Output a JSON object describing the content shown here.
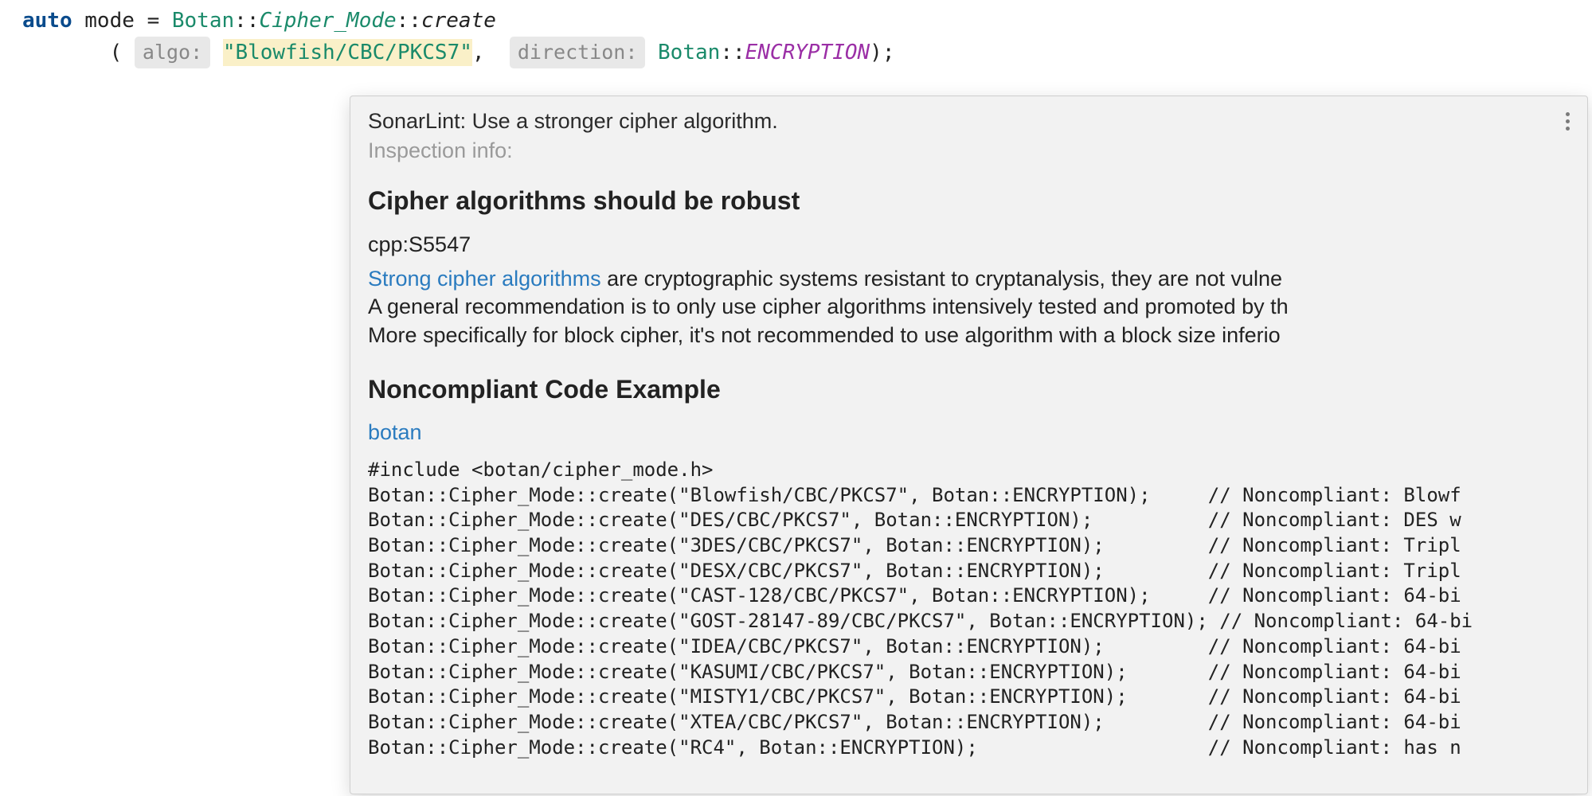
{
  "code": {
    "kw_auto": "auto",
    "var_mode": "mode",
    "eq": "=",
    "botan1": "Botan",
    "dcolon": "::",
    "cipher_mode": "Cipher_Mode",
    "create": "create",
    "lparen": "(",
    "rparen": ")",
    "semi": ";",
    "hint_algo": "algo:",
    "str_algo": "\"Blowfish/CBC/PKCS7\"",
    "comma": ",",
    "hint_direction": "direction:",
    "botan2": "Botan",
    "encryption": "ENCRYPTION"
  },
  "tooltip": {
    "message": "SonarLint: Use a stronger cipher algorithm.",
    "inspection_label": "Inspection info:",
    "rule_title": "Cipher algorithms should be robust",
    "rule_id": "cpp:S5547",
    "link_strong": "Strong cipher algorithms",
    "desc_line1_rest": " are cryptographic systems resistant to cryptanalysis, they are not vulne",
    "desc_line2": "A general recommendation is to only use cipher algorithms intensively tested and promoted by th",
    "desc_line3": "More specifically for block cipher, it's not recommended to use algorithm with a block size inferio",
    "section_noncompliant": "Noncompliant Code Example",
    "botan_link": "botan",
    "codeblock": "#include <botan/cipher_mode.h>\nBotan::Cipher_Mode::create(\"Blowfish/CBC/PKCS7\", Botan::ENCRYPTION);     // Noncompliant: Blowf\nBotan::Cipher_Mode::create(\"DES/CBC/PKCS7\", Botan::ENCRYPTION);          // Noncompliant: DES w\nBotan::Cipher_Mode::create(\"3DES/CBC/PKCS7\", Botan::ENCRYPTION);         // Noncompliant: Tripl\nBotan::Cipher_Mode::create(\"DESX/CBC/PKCS7\", Botan::ENCRYPTION);         // Noncompliant: Tripl\nBotan::Cipher_Mode::create(\"CAST-128/CBC/PKCS7\", Botan::ENCRYPTION);     // Noncompliant: 64-bi\nBotan::Cipher_Mode::create(\"GOST-28147-89/CBC/PKCS7\", Botan::ENCRYPTION); // Noncompliant: 64-bi\nBotan::Cipher_Mode::create(\"IDEA/CBC/PKCS7\", Botan::ENCRYPTION);         // Noncompliant: 64-bi\nBotan::Cipher_Mode::create(\"KASUMI/CBC/PKCS7\", Botan::ENCRYPTION);       // Noncompliant: 64-bi\nBotan::Cipher_Mode::create(\"MISTY1/CBC/PKCS7\", Botan::ENCRYPTION);       // Noncompliant: 64-bi\nBotan::Cipher_Mode::create(\"XTEA/CBC/PKCS7\", Botan::ENCRYPTION);         // Noncompliant: 64-bi\nBotan::Cipher_Mode::create(\"RC4\", Botan::ENCRYPTION);                    // Noncompliant: has n"
  }
}
